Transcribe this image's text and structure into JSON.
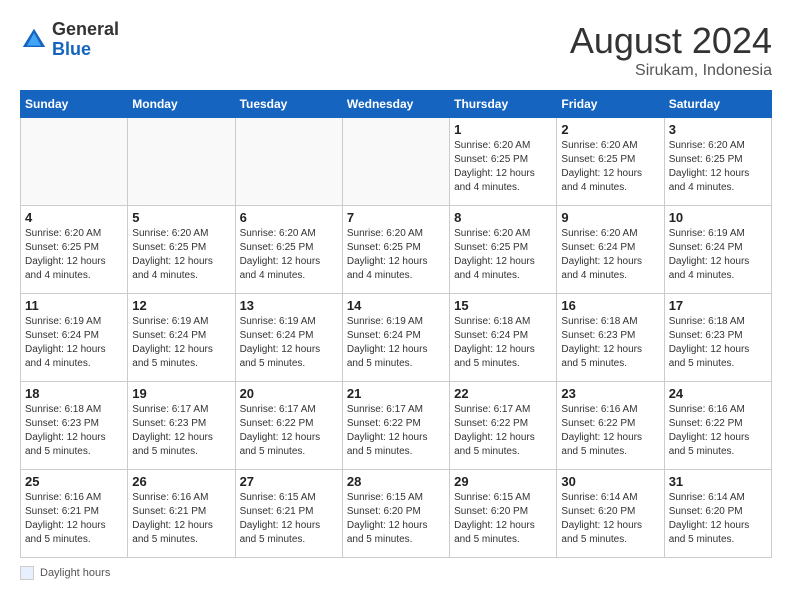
{
  "header": {
    "logo_general": "General",
    "logo_blue": "Blue",
    "month_year": "August 2024",
    "location": "Sirukam, Indonesia"
  },
  "days_of_week": [
    "Sunday",
    "Monday",
    "Tuesday",
    "Wednesday",
    "Thursday",
    "Friday",
    "Saturday"
  ],
  "weeks": [
    [
      {
        "day": "",
        "info": ""
      },
      {
        "day": "",
        "info": ""
      },
      {
        "day": "",
        "info": ""
      },
      {
        "day": "",
        "info": ""
      },
      {
        "day": "1",
        "info": "Sunrise: 6:20 AM\nSunset: 6:25 PM\nDaylight: 12 hours\nand 4 minutes."
      },
      {
        "day": "2",
        "info": "Sunrise: 6:20 AM\nSunset: 6:25 PM\nDaylight: 12 hours\nand 4 minutes."
      },
      {
        "day": "3",
        "info": "Sunrise: 6:20 AM\nSunset: 6:25 PM\nDaylight: 12 hours\nand 4 minutes."
      }
    ],
    [
      {
        "day": "4",
        "info": "Sunrise: 6:20 AM\nSunset: 6:25 PM\nDaylight: 12 hours\nand 4 minutes."
      },
      {
        "day": "5",
        "info": "Sunrise: 6:20 AM\nSunset: 6:25 PM\nDaylight: 12 hours\nand 4 minutes."
      },
      {
        "day": "6",
        "info": "Sunrise: 6:20 AM\nSunset: 6:25 PM\nDaylight: 12 hours\nand 4 minutes."
      },
      {
        "day": "7",
        "info": "Sunrise: 6:20 AM\nSunset: 6:25 PM\nDaylight: 12 hours\nand 4 minutes."
      },
      {
        "day": "8",
        "info": "Sunrise: 6:20 AM\nSunset: 6:25 PM\nDaylight: 12 hours\nand 4 minutes."
      },
      {
        "day": "9",
        "info": "Sunrise: 6:20 AM\nSunset: 6:24 PM\nDaylight: 12 hours\nand 4 minutes."
      },
      {
        "day": "10",
        "info": "Sunrise: 6:19 AM\nSunset: 6:24 PM\nDaylight: 12 hours\nand 4 minutes."
      }
    ],
    [
      {
        "day": "11",
        "info": "Sunrise: 6:19 AM\nSunset: 6:24 PM\nDaylight: 12 hours\nand 4 minutes."
      },
      {
        "day": "12",
        "info": "Sunrise: 6:19 AM\nSunset: 6:24 PM\nDaylight: 12 hours\nand 5 minutes."
      },
      {
        "day": "13",
        "info": "Sunrise: 6:19 AM\nSunset: 6:24 PM\nDaylight: 12 hours\nand 5 minutes."
      },
      {
        "day": "14",
        "info": "Sunrise: 6:19 AM\nSunset: 6:24 PM\nDaylight: 12 hours\nand 5 minutes."
      },
      {
        "day": "15",
        "info": "Sunrise: 6:18 AM\nSunset: 6:24 PM\nDaylight: 12 hours\nand 5 minutes."
      },
      {
        "day": "16",
        "info": "Sunrise: 6:18 AM\nSunset: 6:23 PM\nDaylight: 12 hours\nand 5 minutes."
      },
      {
        "day": "17",
        "info": "Sunrise: 6:18 AM\nSunset: 6:23 PM\nDaylight: 12 hours\nand 5 minutes."
      }
    ],
    [
      {
        "day": "18",
        "info": "Sunrise: 6:18 AM\nSunset: 6:23 PM\nDaylight: 12 hours\nand 5 minutes."
      },
      {
        "day": "19",
        "info": "Sunrise: 6:17 AM\nSunset: 6:23 PM\nDaylight: 12 hours\nand 5 minutes."
      },
      {
        "day": "20",
        "info": "Sunrise: 6:17 AM\nSunset: 6:22 PM\nDaylight: 12 hours\nand 5 minutes."
      },
      {
        "day": "21",
        "info": "Sunrise: 6:17 AM\nSunset: 6:22 PM\nDaylight: 12 hours\nand 5 minutes."
      },
      {
        "day": "22",
        "info": "Sunrise: 6:17 AM\nSunset: 6:22 PM\nDaylight: 12 hours\nand 5 minutes."
      },
      {
        "day": "23",
        "info": "Sunrise: 6:16 AM\nSunset: 6:22 PM\nDaylight: 12 hours\nand 5 minutes."
      },
      {
        "day": "24",
        "info": "Sunrise: 6:16 AM\nSunset: 6:22 PM\nDaylight: 12 hours\nand 5 minutes."
      }
    ],
    [
      {
        "day": "25",
        "info": "Sunrise: 6:16 AM\nSunset: 6:21 PM\nDaylight: 12 hours\nand 5 minutes."
      },
      {
        "day": "26",
        "info": "Sunrise: 6:16 AM\nSunset: 6:21 PM\nDaylight: 12 hours\nand 5 minutes."
      },
      {
        "day": "27",
        "info": "Sunrise: 6:15 AM\nSunset: 6:21 PM\nDaylight: 12 hours\nand 5 minutes."
      },
      {
        "day": "28",
        "info": "Sunrise: 6:15 AM\nSunset: 6:20 PM\nDaylight: 12 hours\nand 5 minutes."
      },
      {
        "day": "29",
        "info": "Sunrise: 6:15 AM\nSunset: 6:20 PM\nDaylight: 12 hours\nand 5 minutes."
      },
      {
        "day": "30",
        "info": "Sunrise: 6:14 AM\nSunset: 6:20 PM\nDaylight: 12 hours\nand 5 minutes."
      },
      {
        "day": "31",
        "info": "Sunrise: 6:14 AM\nSunset: 6:20 PM\nDaylight: 12 hours\nand 5 minutes."
      }
    ]
  ],
  "footer": {
    "label": "Daylight hours"
  }
}
